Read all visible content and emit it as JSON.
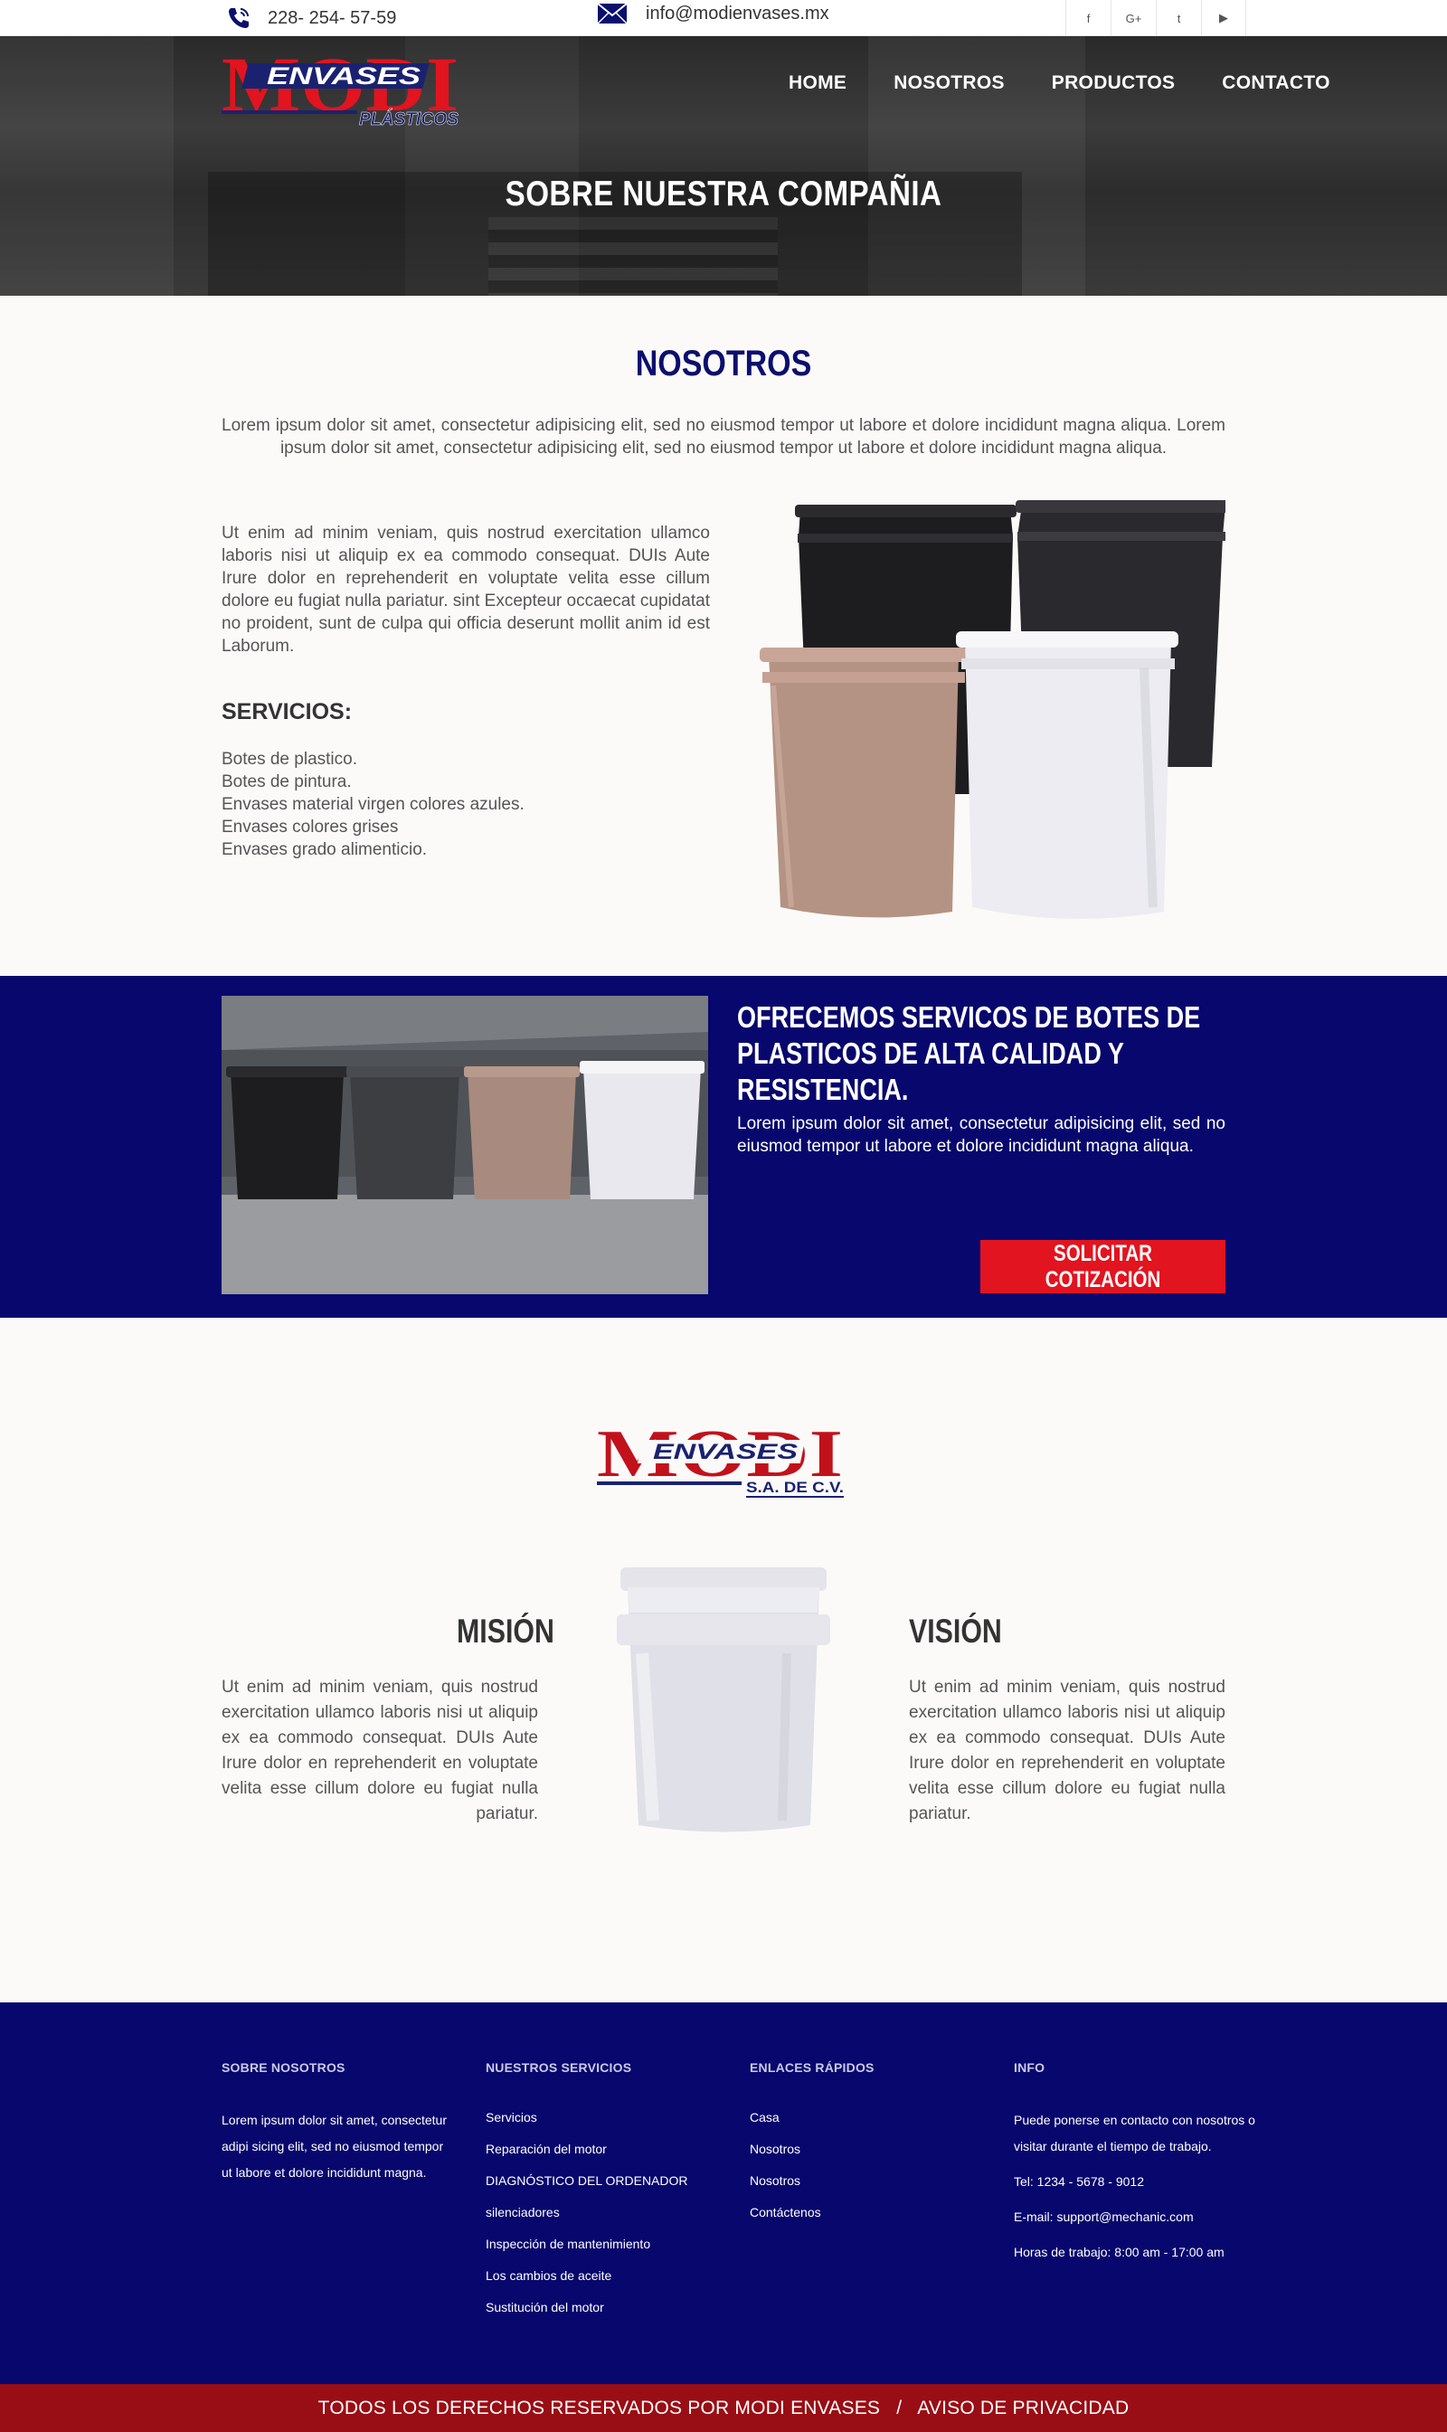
{
  "topbar": {
    "phone": "228- 254- 57-59",
    "email": "info@modienvases.mx",
    "socials": [
      "facebook-icon",
      "google-plus-icon",
      "twitter-icon",
      "youtube-icon"
    ],
    "social_glyphs": [
      "f",
      "G+",
      "t",
      "▶"
    ]
  },
  "logo": {
    "word": "MODI",
    "sub": "ENVASES",
    "tag": "PLÁSTICOS",
    "sa": "S.A. DE C.V."
  },
  "nav": {
    "home": "HOME",
    "nosotros": "NOSOTROS",
    "productos": "PRODUCTOS",
    "contacto": "CONTACTO"
  },
  "hero": {
    "title": "SOBRE NUESTRA COMPAÑIA"
  },
  "nosotros": {
    "title": "NOSOTROS",
    "intro": "Lorem ipsum dolor sit amet, consectetur adipisicing elit, sed no eiusmod tempor ut labore et dolore incididunt magna aliqua. Lorem ipsum dolor sit amet, consectetur adipisicing elit, sed no eiusmod tempor ut labore et dolore incididunt magna aliqua.",
    "para": "Ut enim ad minim veniam, quis nostrud exercitation ullamco laboris nisi ut aliquip ex ea commodo consequat. DUIs Aute Irure dolor en reprehenderit en voluptate velita esse cillum dolore eu fugiat nulla pariatur. sint Excepteur occaecat cupidatat no proident, sunt de culpa qui officia deserunt mollit anim id est Laborum.",
    "servicios_title": "SERVICIOS:",
    "servicios": [
      "Botes de plastico.",
      "Botes de pintura.",
      "Envases material virgen colores azules.",
      "Envases colores grises",
      "Envases grado alimenticio."
    ]
  },
  "band": {
    "title": "OFRECEMOS SERVICOS DE BOTES DE PLASTICOS DE ALTA CALIDAD Y RESISTENCIA.",
    "text": "Lorem ipsum dolor sit amet, consectetur adipisicing elit, sed no eiusmod tempor ut labore et dolore incididunt magna aliqua.",
    "cta": "SOLICITAR COTIZACIÓN"
  },
  "mision": {
    "title": "MISIÓN",
    "text": "Ut enim ad minim veniam, quis nostrud exercitation ullamco laboris nisi ut aliquip ex ea commodo consequat. DUIs Aute Irure dolor en reprehenderit en voluptate velita esse cillum dolore eu fugiat nulla pariatur."
  },
  "vision": {
    "title": "VISIÓN",
    "text": "Ut enim ad minim veniam, quis nostrud exercitation ullamco laboris nisi ut aliquip ex ea commodo consequat. DUIs Aute Irure dolor en reprehenderit en voluptate velita esse cillum dolore eu fugiat nulla pariatur."
  },
  "footer": {
    "sobre": {
      "title": "SOBRE NOSOTROS",
      "text": "Lorem ipsum dolor sit amet, consectetur adipi sicing elit, sed no eiusmod tempor ut labore et dolore incididunt magna."
    },
    "servicios": {
      "title": "NUESTROS SERVICIOS",
      "items": [
        "Servicios",
        "Reparación del motor",
        "DIAGNÓSTICO DEL ORDENADOR",
        "silenciadores",
        "Inspección de mantenimiento",
        "Los cambios de aceite",
        "Sustitución del motor"
      ]
    },
    "enlaces": {
      "title": "ENLACES RÁPIDOS",
      "items": [
        "Casa",
        "Nosotros",
        "Nosotros",
        "Contáctenos"
      ]
    },
    "info": {
      "title": "INFO",
      "text": "Puede ponerse en contacto con nosotros o visitar durante el tiempo de trabajo.",
      "tel": "Tel: 1234 - 5678 - 9012",
      "email": "E-mail: support@mechanic.com",
      "horas": "Horas de trabajo: 8:00 am - 17:00 am"
    },
    "copyright": "TODOS LOS DERECHOS RESERVADOS POR MODI ENVASES",
    "separator": "/",
    "privacy": "AVISO DE PRIVACIDAD"
  },
  "colors": {
    "navy": "#07076d",
    "title_navy": "#0b0f6e",
    "red": "#e2141f",
    "dark_red": "#990e14",
    "logo_red": "#c1121c"
  }
}
